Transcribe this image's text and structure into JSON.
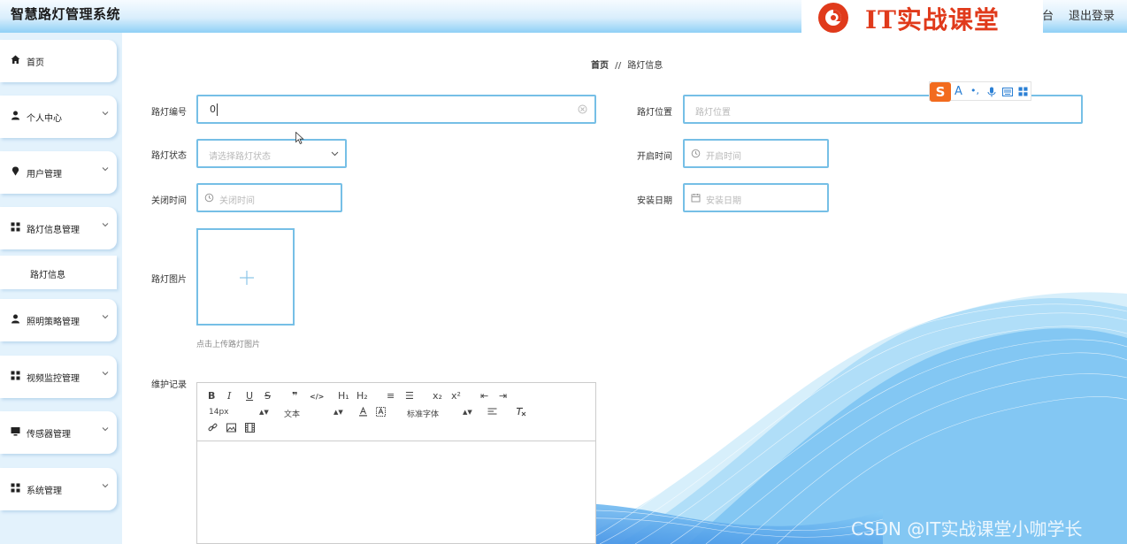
{
  "header": {
    "app_title": "智慧路灯管理系统",
    "brand_text": "IT实战课堂",
    "partial_link": "台",
    "logout_label": "退出登录"
  },
  "sidebar": {
    "items": [
      {
        "label": "首页",
        "icon": "home-icon"
      },
      {
        "label": "个人中心",
        "icon": "user-icon"
      },
      {
        "label": "用户管理",
        "icon": "pin-icon"
      },
      {
        "label": "路灯信息管理",
        "icon": "grid-icon"
      },
      {
        "label": "照明策略管理",
        "icon": "user-icon"
      },
      {
        "label": "视频监控管理",
        "icon": "grid-icon"
      },
      {
        "label": "传感器管理",
        "icon": "monitor-icon"
      },
      {
        "label": "系统管理",
        "icon": "grid-icon"
      }
    ],
    "sub_item": "路灯信息"
  },
  "breadcrumb": {
    "home": "首页",
    "separator": "//",
    "current": "路灯信息"
  },
  "form": {
    "number": {
      "label": "路灯编号",
      "value": "0"
    },
    "location": {
      "label": "路灯位置",
      "placeholder": "路灯位置"
    },
    "status": {
      "label": "路灯状态",
      "placeholder": "请选择路灯状态"
    },
    "open_time": {
      "label": "开启时间",
      "placeholder": "开启时间"
    },
    "close_time": {
      "label": "关闭时间",
      "placeholder": "关闭时间"
    },
    "install_date": {
      "label": "安装日期",
      "placeholder": "安装日期"
    },
    "image": {
      "label": "路灯图片",
      "tip": "点击上传路灯图片"
    },
    "maintenance": {
      "label": "维护记录"
    }
  },
  "editor": {
    "row1": [
      "B",
      "I",
      "U",
      "S",
      "❞",
      "</>",
      "H₁",
      "H₂",
      "≡",
      "☰",
      "x₂",
      "x²",
      "⇤",
      "⇥"
    ],
    "font_size": "14px",
    "text_type": "文本",
    "font_family": "标准字体"
  },
  "watermark": "CSDN @IT实战课堂小咖学长",
  "colors": {
    "accent": "#76bfe6",
    "brand": "#e03a1b",
    "sidebar_bg": "#e3f2fc"
  }
}
